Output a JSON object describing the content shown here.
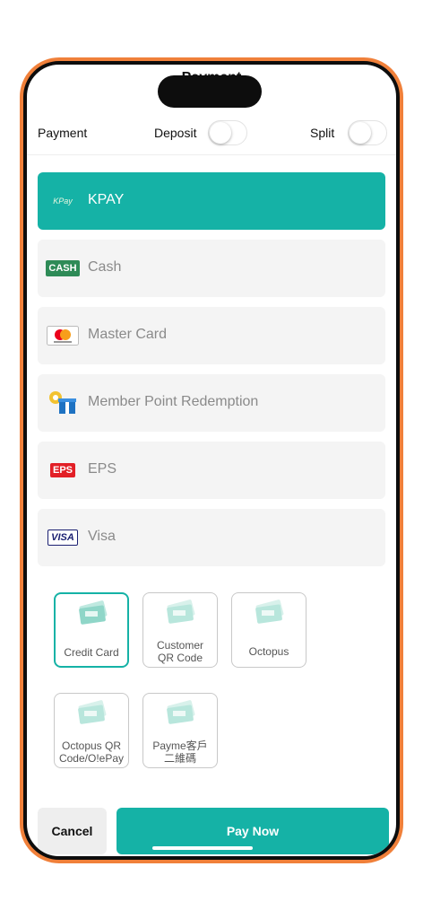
{
  "header": {
    "title": "Payment"
  },
  "options_row": {
    "payment_label": "Payment",
    "deposit_label": "Deposit",
    "split_label": "Split"
  },
  "methods": [
    {
      "name": "KPAY",
      "icon": "kpay-logo-icon",
      "icon_text": "KPay",
      "selected": true
    },
    {
      "name": "Cash",
      "icon": "cash-icon",
      "icon_text": "CASH"
    },
    {
      "name": "Master Card",
      "icon": "mastercard-icon"
    },
    {
      "name": "Member Point Redemption",
      "icon": "gift-icon"
    },
    {
      "name": "EPS",
      "icon": "eps-icon",
      "icon_text": "EPS"
    },
    {
      "name": "Visa",
      "icon": "visa-icon",
      "icon_text": "VISA"
    }
  ],
  "tiles": [
    {
      "line1": "Credit Card",
      "line2": "",
      "selected": true
    },
    {
      "line1": "Customer",
      "line2": "QR Code"
    },
    {
      "line1": "Octopus",
      "line2": ""
    },
    {
      "line1": "Octopus QR",
      "line2": "Code/O!ePay"
    },
    {
      "line1": "Payme客戶",
      "line2": "二維碼"
    }
  ],
  "footer": {
    "cancel_label": "Cancel",
    "pay_label": "Pay Now"
  },
  "colors": {
    "accent": "#15b2a6",
    "frame": "#f0803a"
  }
}
